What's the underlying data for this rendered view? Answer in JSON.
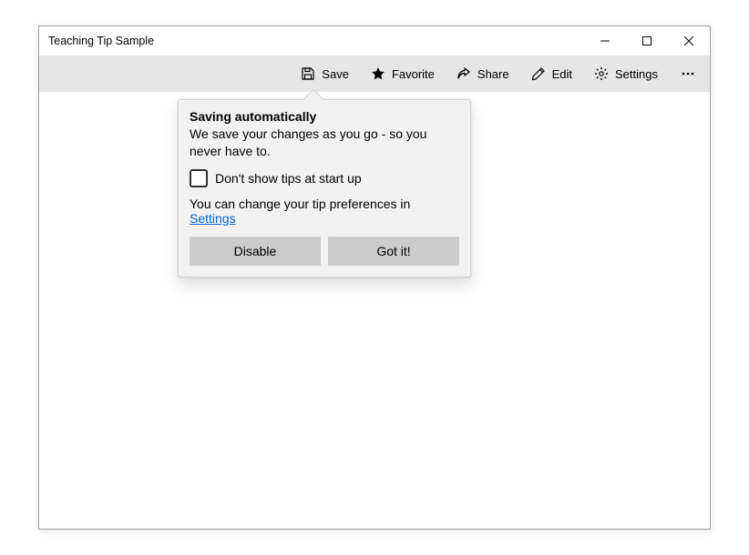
{
  "window": {
    "title": "Teaching Tip Sample"
  },
  "commandbar": {
    "save": "Save",
    "favorite": "Favorite",
    "share": "Share",
    "edit": "Edit",
    "settings": "Settings"
  },
  "tip": {
    "title": "Saving automatically",
    "subtitle": "We save your changes as you go - so you never have to.",
    "checkbox_label": "Don't show tips at start up",
    "footer_text": "You can change your tip preferences in ",
    "footer_link": "Settings",
    "disable": "Disable",
    "gotit": "Got it!"
  }
}
